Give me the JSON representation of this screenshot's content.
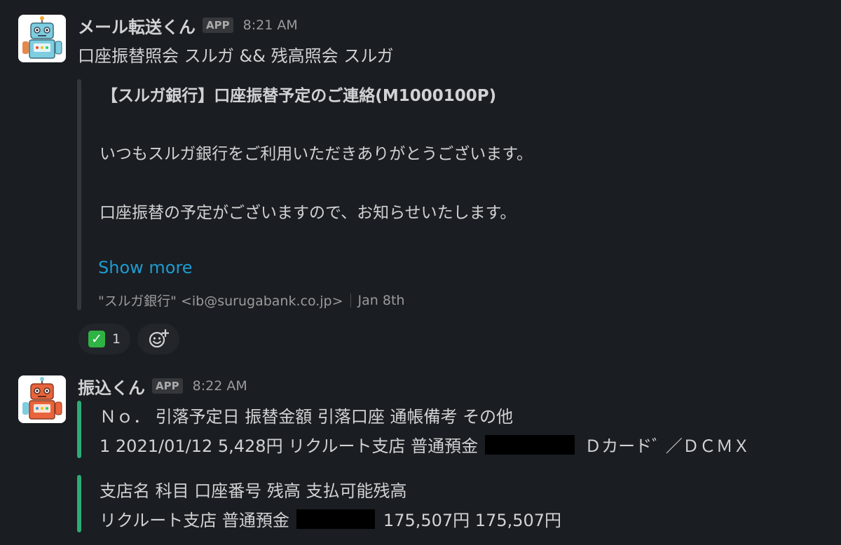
{
  "message1": {
    "sender": "メール転送くん",
    "badge": "APP",
    "time": "8:21 AM",
    "text": "口座振替照会 スルガ && 残高照会 スルガ",
    "attachment": {
      "title": "【スルガ銀行】口座振替予定のご連絡(M1000100P)",
      "body_line1": "いつもスルガ銀行をご利用いただきありがとうございます。",
      "body_line2": "口座振替の予定がございますので、お知らせいたします。",
      "show_more": "Show more",
      "footer_from": "\"スルガ銀行\" <ib@surugabank.co.jp>",
      "footer_date": "Jan 8th"
    },
    "reactions": [
      {
        "emoji": "✓",
        "count": "1"
      }
    ]
  },
  "message2": {
    "sender": "振込くん",
    "badge": "APP",
    "time": "8:22 AM",
    "block1": {
      "header": "Ｎｏ．  引落予定日 振替金額 引落口座 通帳備考 その他",
      "row_prefix": "1 2021/01/12 5,428円 リクルート支店 普通預金",
      "row_suffix": "Ｄカードﾞ ／ＤＣＭＸ"
    },
    "block2": {
      "header": "支店名 科目 口座番号 残高 支払可能残高",
      "row_prefix": "リクルート支店 普通預金",
      "row_suffix": "175,507円 175,507円"
    }
  },
  "colors": {
    "background": "#1a1d21",
    "link": "#1d9bd1",
    "field_bar": "#2bac76",
    "attachment_bar": "#35373b",
    "reaction_check": "#2fb344"
  },
  "icons": {
    "avatar1": "robot-blue-icon",
    "avatar2": "robot-orange-icon",
    "reaction": "white-check-mark-icon",
    "add_reaction": "add-emoji-icon"
  }
}
